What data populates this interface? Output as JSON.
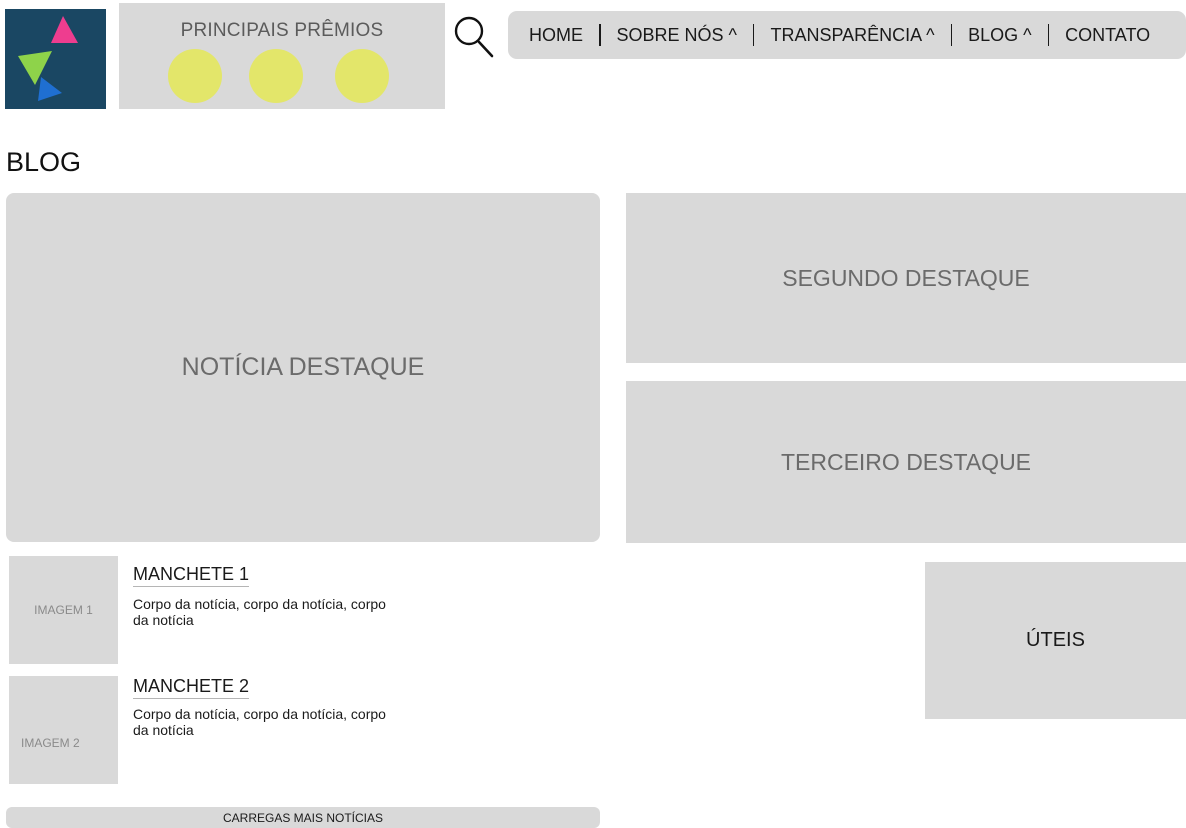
{
  "header": {
    "logo_name": "brand-logo",
    "awards_title": "PRINCIPAIS PRÊMIOS",
    "award_color": "#e3e66a",
    "nav": [
      {
        "label": "HOME"
      },
      {
        "label": "SOBRE NÓS ^"
      },
      {
        "label": "TRANSPARÊNCIA ^"
      },
      {
        "label": "BLOG ^"
      },
      {
        "label": "CONTATO"
      }
    ]
  },
  "page": {
    "title": "BLOG"
  },
  "features": {
    "main": "NOTÍCIA DESTAQUE",
    "second": "SEGUNDO DESTAQUE",
    "third": "TERCEIRO DESTAQUE"
  },
  "news": [
    {
      "image_label": "IMAGEM 1",
      "headline": "MANCHETE 1",
      "body": "Corpo da notícia, corpo da notícia, corpo da notícia"
    },
    {
      "image_label": "IMAGEM 2",
      "headline": "MANCHETE 2",
      "body": "Corpo da notícia, corpo da notícia, corpo da notícia"
    }
  ],
  "sidebar": {
    "useful_label": "ÚTEIS"
  },
  "load_more_label": "CARREGAS MAIS NOTÍCIAS",
  "colors": {
    "logo_bg": "#1a4763",
    "logo_pink": "#ee3d8f",
    "logo_green": "#8ed34a",
    "logo_blue": "#1f6fd1",
    "panel": "#d9d9d9"
  }
}
